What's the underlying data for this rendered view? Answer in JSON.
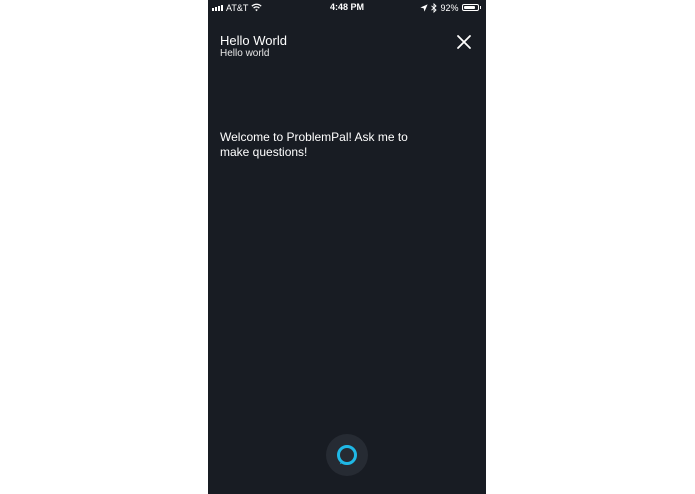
{
  "status_bar": {
    "carrier": "AT&T",
    "time": "4:48 PM",
    "battery_percent": "92%",
    "battery_level": 0.92,
    "icons": [
      "signal-icon",
      "wifi-icon",
      "location-icon",
      "bluetooth-icon",
      "battery-icon"
    ]
  },
  "header": {
    "title": "Hello World",
    "subtitle": "Hello world",
    "close_icon": "close-icon"
  },
  "main": {
    "message": "Welcome to ProblemPal! Ask me to make questions!"
  },
  "footer": {
    "alexa_icon": "alexa-ring-icon"
  },
  "colors": {
    "background": "#181c23",
    "text": "#ffffff",
    "alexa_accent": "#1fb8e6",
    "alexa_button_bg": "#262b33"
  }
}
